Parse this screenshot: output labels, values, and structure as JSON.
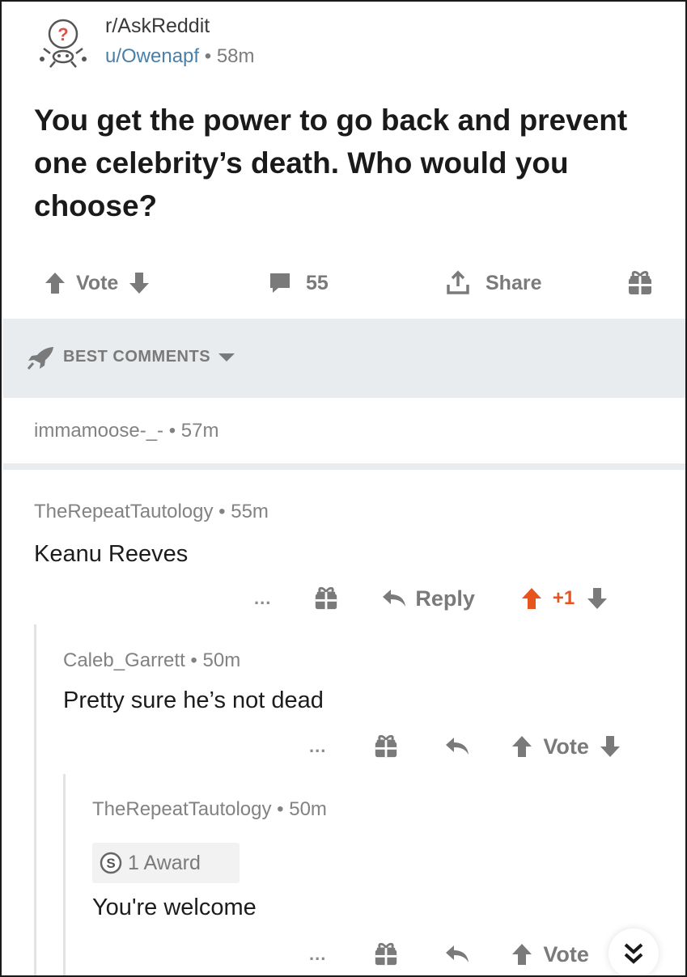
{
  "post": {
    "subreddit": "r/AskReddit",
    "author": "u/Owenapf",
    "time": "58m",
    "title": "You get the power to go back and prevent one celebrity’s death. Who would you choose?",
    "vote_label": "Vote",
    "comment_count": "55",
    "share_label": "Share"
  },
  "sort": {
    "label": "BEST COMMENTS"
  },
  "comments": [
    {
      "author": "immamoose-_-",
      "time": "57m"
    },
    {
      "author": "TheRepeatTautology",
      "time": "55m",
      "body": "Keanu Reeves",
      "reply_label": "Reply",
      "score": "+1"
    },
    {
      "author": "Caleb_Garrett",
      "time": "50m",
      "body": "Pretty sure he’s not dead",
      "vote_label": "Vote"
    },
    {
      "author": "TheRepeatTautology",
      "time": "50m",
      "award": "1 Award",
      "body": "You're welcome",
      "vote_label": "Vote"
    }
  ],
  "separator": "•",
  "more_label": "...",
  "colors": {
    "upvote_active": "#e8541e",
    "text_muted": "#7a7a7a",
    "band": "#e9ecee",
    "user_link": "#4a7fa8"
  },
  "icons": [
    "subreddit-snoo-icon",
    "upvote-icon",
    "downvote-icon",
    "comment-icon",
    "share-icon",
    "gift-icon",
    "rocket-icon",
    "caret-down-icon",
    "reply-icon",
    "award-coin-icon",
    "collapse-chevron-icon"
  ]
}
